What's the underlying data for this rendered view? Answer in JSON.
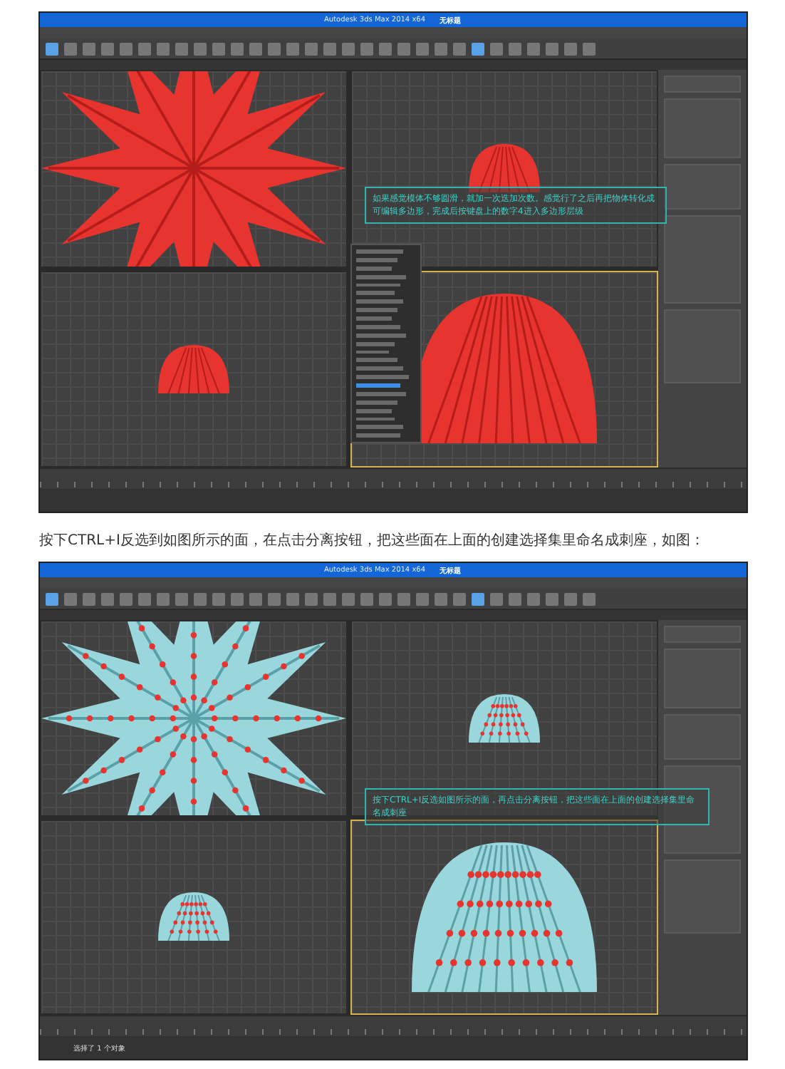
{
  "screenshots": [
    {
      "kind": "solid",
      "window": {
        "title": "Autodesk 3ds Max 2014 x64",
        "document": "无标题"
      },
      "viewports": [
        {
          "kind": "star",
          "active": false
        },
        {
          "kind": "dome",
          "active": false
        },
        {
          "kind": "dome",
          "active": false
        },
        {
          "kind": "cactus",
          "active": true
        }
      ],
      "callout": "如果感觉模体不够圆滑，就加一次迭加次数。感觉行了之后再把物体转化成可编辑多边形，完成后按键盘上的数字4进入多边形层级",
      "context_menu": true
    },
    {
      "kind": "selection",
      "window": {
        "title": "Autodesk 3ds Max 2014 x64",
        "document": "无标题"
      },
      "viewports": [
        {
          "kind": "star",
          "active": false
        },
        {
          "kind": "dome",
          "active": false
        },
        {
          "kind": "dome",
          "active": false
        },
        {
          "kind": "cactus",
          "active": true
        }
      ],
      "callout": "按下CTRL+I反选如图所示的面，再点击分离按钮，把这些面在上面的创建选择集里命名成刺座",
      "context_menu": false,
      "status": [
        "选择了 1 个对象"
      ]
    }
  ],
  "caption": "按下CTRL+I反选到如图所示的面，在点击分离按钮，把这些面在上面的创建选择集里命名成刺座，如图："
}
